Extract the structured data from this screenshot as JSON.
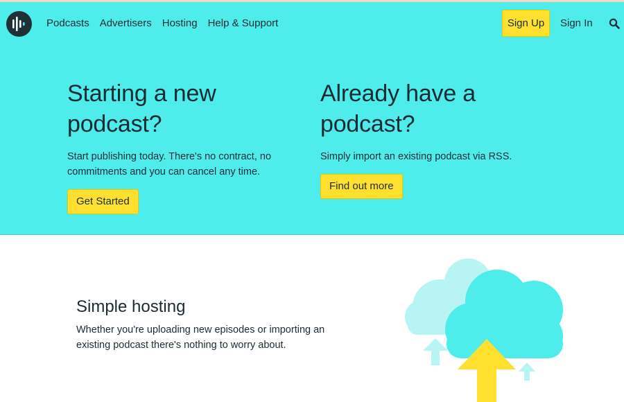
{
  "nav": {
    "links": [
      "Podcasts",
      "Advertisers",
      "Hosting",
      "Help & Support"
    ],
    "signup_label": "Sign Up",
    "signin_label": "Sign In"
  },
  "hero": {
    "left": {
      "title_line1": "Starting a new",
      "title_line2": "podcast?",
      "text": "Start publishing today. There's no contract, no commitments and you can cancel any time.",
      "button_label": "Get Started"
    },
    "right": {
      "title_line1": "Already have a",
      "title_line2": "podcast?",
      "text": "Simply import an existing podcast via RSS.",
      "button_label": "Find out more"
    }
  },
  "feature": {
    "title": "Simple hosting",
    "text": "Whether you're uploading new episodes or importing an existing podcast there's nothing to worry about."
  },
  "colors": {
    "hero_bg": "#4eecea",
    "accent_yellow": "#ffe02e",
    "text_dark": "#1b2b33",
    "cloud_light": "#b8f4f4",
    "cloud_main": "#4eecea"
  },
  "icons": [
    "logo-icon",
    "search-icon",
    "upload-cloud-illustration"
  ]
}
